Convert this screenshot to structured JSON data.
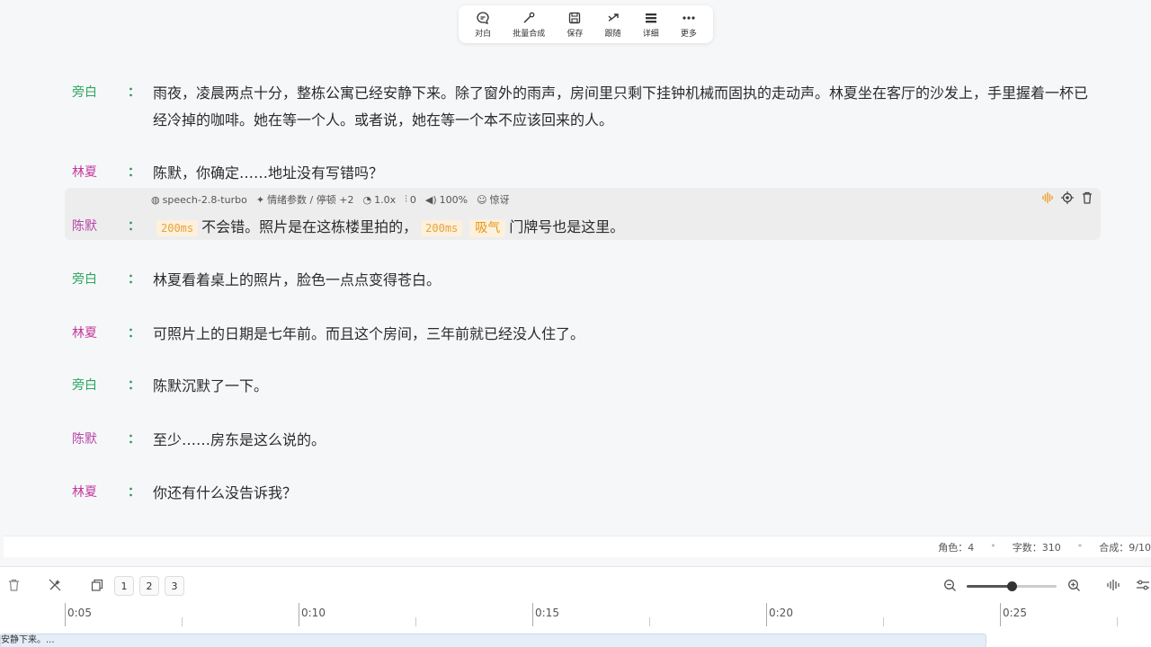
{
  "toolbar": {
    "items": [
      {
        "label": "对白",
        "icon": "chat-bubble-icon"
      },
      {
        "label": "批量合成",
        "icon": "magic-wand-icon"
      },
      {
        "label": "保存",
        "icon": "save-icon"
      },
      {
        "label": "跟随",
        "icon": "follow-icon"
      },
      {
        "label": "详细",
        "icon": "list-detail-icon"
      },
      {
        "label": "更多",
        "icon": "more-dots-icon"
      }
    ]
  },
  "colon": "：",
  "lines": [
    {
      "speaker": "旁白",
      "text": "雨夜，凌晨两点十分，整栋公寓已经安静下来。除了窗外的雨声，房间里只剩下挂钟机械而固执的走动声。林夏坐在客厅的沙发上，手里握着一杯已经冷掉的咖啡。她在等一个人。或者说，她在等一个本不应该回来的人。"
    },
    {
      "speaker": "林夏",
      "text": "陈默，你确定……地址没有写错吗？"
    },
    {
      "speaker": "陈默",
      "pause1": "200ms",
      "seg1": "不会错。照片是在这栋楼里拍的，",
      "pause2": "200ms",
      "breath": "吸气",
      "seg2": "门牌号也是这里。"
    },
    {
      "speaker": "旁白",
      "text": "林夏看着桌上的照片，脸色一点点变得苍白。"
    },
    {
      "speaker": "林夏",
      "text": "可照片上的日期是七年前。而且这个房间，三年前就已经没人住了。"
    },
    {
      "speaker": "旁白",
      "text": "陈默沉默了一下。"
    },
    {
      "speaker": "陈默",
      "text": "至少……房东是这么说的。"
    },
    {
      "speaker": "林夏",
      "text": "你还有什么没告诉我？"
    }
  ],
  "active_meta": {
    "model": "speech-2.8-turbo",
    "emotion": "情绪参数 / 停顿 +2",
    "speed": "1.0x",
    "pitch": "0",
    "volume": "100%",
    "mood": "惊讶"
  },
  "status": {
    "roles": "角色：4",
    "chars": "字数：310",
    "synth": "合成：9/10"
  },
  "bottom": {
    "pages": [
      "1",
      "2",
      "3"
    ],
    "zoom_level": 0.5,
    "ticks": [
      "0:05",
      "0:10",
      "0:15",
      "0:20",
      "0:25"
    ],
    "clip_text": "安静下来。..."
  }
}
